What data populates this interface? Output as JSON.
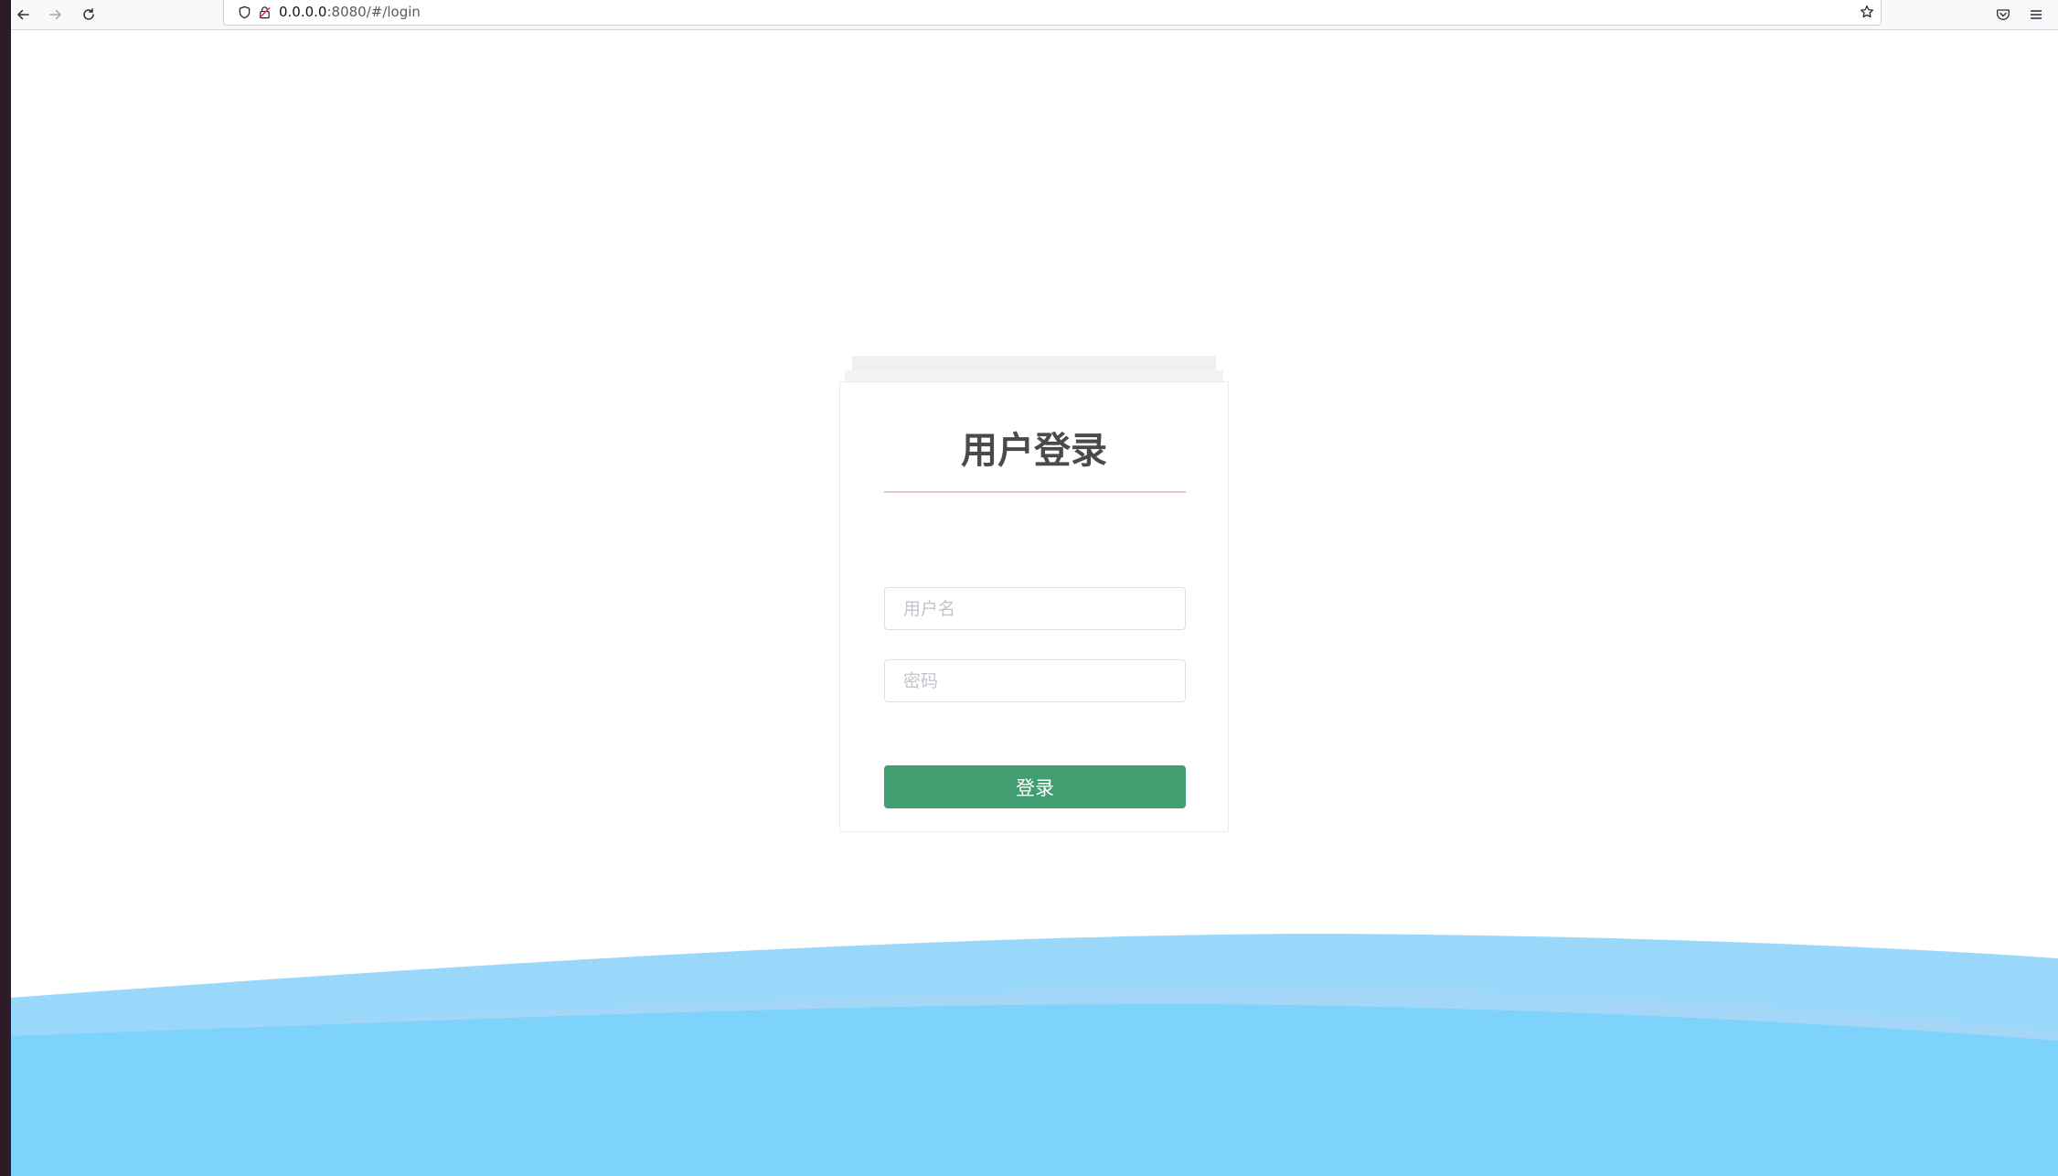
{
  "browser": {
    "url_host": "0.0.0.0",
    "url_rest": ":8080/#/login",
    "icons": {
      "back": "arrow-left-icon",
      "forward": "arrow-right-icon",
      "reload": "reload-icon",
      "tracking": "shield-icon",
      "security": "insecure-lock-icon",
      "bookmark": "star-icon",
      "pocket": "pocket-icon",
      "menu": "hamburger-menu-icon"
    }
  },
  "login": {
    "title": "用户登录",
    "username_placeholder": "用户名",
    "password_placeholder": "密码",
    "submit_label": "登录"
  },
  "colors": {
    "button": "#409e70",
    "underline": "#e8c4c8",
    "wave_light": "#9ad8fb",
    "wave_main": "#7dd3fb",
    "title": "#4a4a4a"
  }
}
